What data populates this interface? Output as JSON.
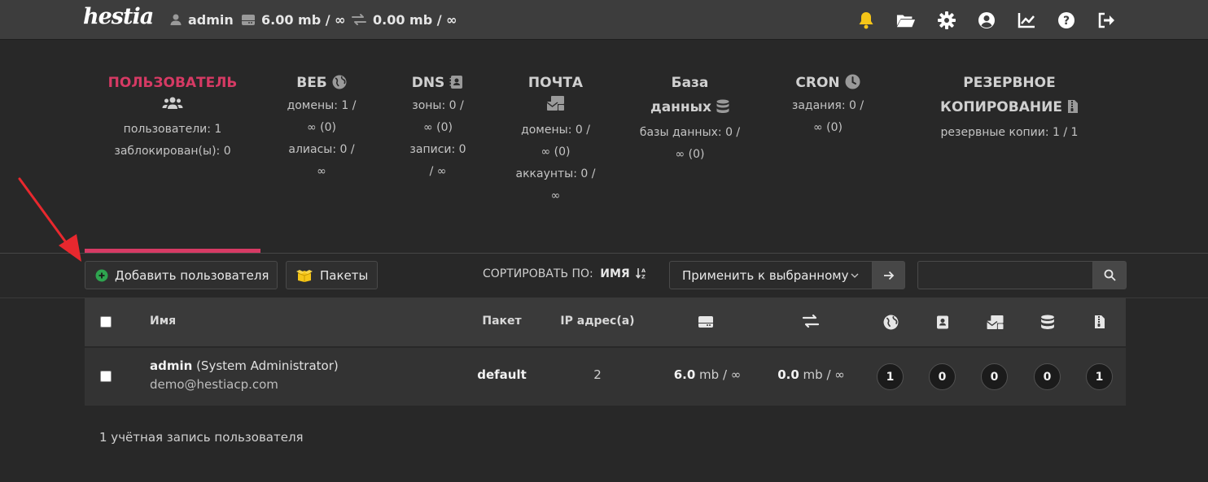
{
  "topbar": {
    "logo": "hestia",
    "user": "admin",
    "disk_value": "6.00",
    "disk_unit": " mb / ∞",
    "bandwidth_value": "0.00",
    "bandwidth_unit": " mb / ∞",
    "icons": [
      "bell-icon",
      "folder-icon",
      "gear-icon",
      "user-circle-icon",
      "chart-icon",
      "help-icon",
      "logout-icon"
    ],
    "accent": "#f5c518"
  },
  "stats": [
    {
      "title": "ПОЛЬЗОВАТЕЛЬ",
      "lines": [
        "пользователи: 1",
        "заблокирован(ы): 0"
      ]
    },
    {
      "title": "ВЕБ",
      "lines": [
        "домены: 1 /",
        "∞ (0)",
        "алиасы: 0 /",
        "∞"
      ]
    },
    {
      "title": "DNS",
      "lines": [
        "зоны: 0 /",
        "∞ (0)",
        "записи: 0",
        "/ ∞"
      ]
    },
    {
      "title": "ПОЧТА",
      "lines": [
        "домены: 0 /",
        "∞ (0)",
        "аккаунты: 0 /",
        "∞"
      ]
    },
    {
      "title_1": "База",
      "title_2": "данных",
      "lines": [
        "базы данных: 0 /",
        "∞ (0)"
      ]
    },
    {
      "title": "CRON",
      "lines": [
        "задания: 0 /",
        "∞ (0)"
      ]
    },
    {
      "title_1": "РЕЗЕРВНОЕ",
      "title_2": "КОПИРОВАНИЕ",
      "lines": [
        "резервные копии: 1 / 1"
      ]
    }
  ],
  "toolbar": {
    "add_user": "Добавить пользователя",
    "packages": "Пакеты",
    "sort_label": "СОРТИРОВАТЬ ПО:",
    "sort_value": "ИМЯ",
    "bulk_action": "Применить к выбранному",
    "search_value": ""
  },
  "table": {
    "headers": {
      "name": "Имя",
      "package": "Пакет",
      "ips": "IP адрес(а)"
    },
    "row": {
      "username": "admin",
      "fullname": " (System Administrator)",
      "email": "demo@hestiacp.com",
      "package": "default",
      "ips": "2",
      "disk_value": "6.0",
      "disk_unit": " mb / ∞",
      "bw_value": "0.0",
      "bw_unit": " mb / ∞",
      "web": "1",
      "dns": "0",
      "mail": "0",
      "db": "0",
      "backup": "1"
    }
  },
  "footer": "1 учётная запись пользователя",
  "colors": {
    "accent_pink": "#d63a64",
    "green": "#2ea44f",
    "arrow_red": "#e8282e"
  }
}
